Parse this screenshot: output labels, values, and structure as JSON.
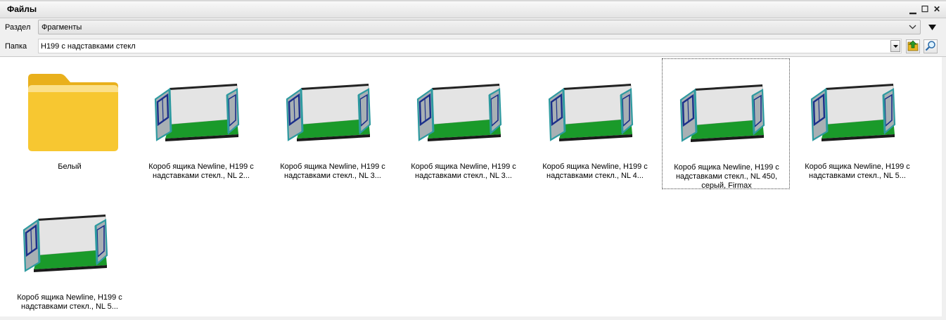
{
  "window": {
    "title": "Файлы",
    "minimize_glyph": "▁",
    "maximize_glyph": "☐",
    "close_glyph": "✕"
  },
  "section": {
    "label": "Раздел",
    "value": "Фрагменты"
  },
  "folder": {
    "label": "Папка",
    "value": "Н199 с надставками стекл"
  },
  "items": [
    {
      "type": "folder",
      "caption": "Белый"
    },
    {
      "type": "drawer",
      "caption": "Короб ящика Newline, H199 с надставками стекл., NL 2..."
    },
    {
      "type": "drawer",
      "caption": "Короб ящика Newline, H199 с надставками стекл., NL 3..."
    },
    {
      "type": "drawer",
      "caption": "Короб ящика Newline, H199 с надставками стекл., NL 3..."
    },
    {
      "type": "drawer",
      "caption": "Короб ящика Newline, H199 с надставками стекл., NL 4..."
    },
    {
      "type": "drawer",
      "caption": "Короб ящика Newline, H199 с надставками стекл., NL 450, серый, Firmax",
      "selected": true
    },
    {
      "type": "drawer",
      "caption": "Короб ящика Newline, H199 с надставками стекл., NL 5..."
    },
    {
      "type": "drawer",
      "caption": "Короб ящика Newline, H199 с надставками стекл., NL 5..."
    }
  ],
  "colors": {
    "folder_yellow": "#f7c731",
    "drawer_green": "#1a9a2a",
    "drawer_frame": "#2e9aa0"
  }
}
